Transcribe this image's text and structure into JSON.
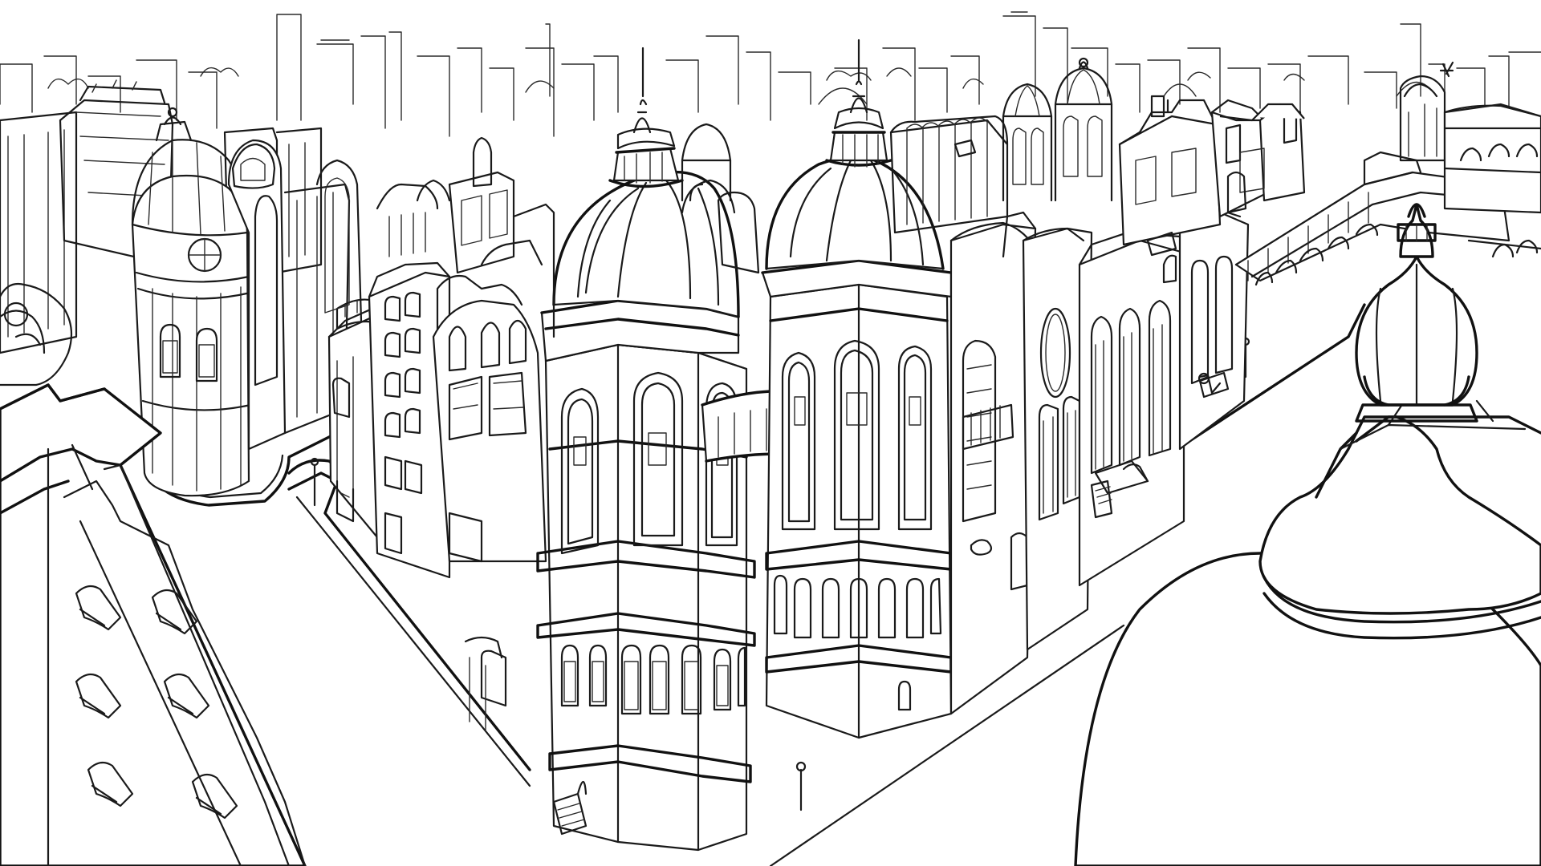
{
  "image": {
    "background_color": "#ffffff",
    "ink_color": "#1a1a1a"
  }
}
